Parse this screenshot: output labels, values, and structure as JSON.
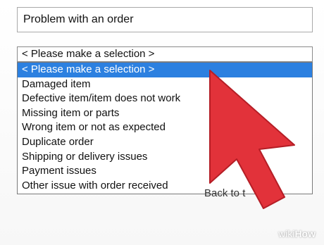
{
  "top_field": {
    "value": "Problem with an order"
  },
  "issue_select": {
    "value": "< Please make a selection >",
    "options": [
      "< Please make a selection >",
      "Damaged item",
      "Defective item/item does not work",
      "Missing item or parts",
      "Wrong item or not as expected",
      "Duplicate order",
      "Shipping or delivery issues",
      "Payment issues",
      "Other issue with order received"
    ],
    "highlighted_index": 0
  },
  "back_link": {
    "label": "Back to t"
  },
  "cursor_overlay": {
    "icon": "arrow-pointer-icon",
    "color": "#e2323a"
  },
  "colors": {
    "highlight": "#2c80e0",
    "cursor": "#e2323a"
  },
  "watermark": {
    "part1": "wiki",
    "part2": "How"
  }
}
